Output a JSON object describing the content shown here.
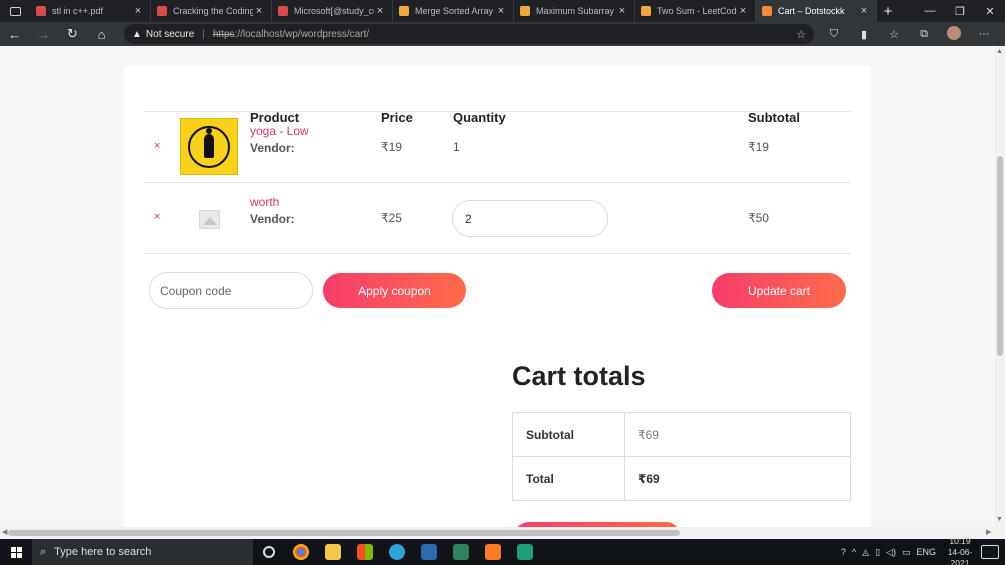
{
  "browser": {
    "tabs": [
      {
        "label": "stl in c++.pdf",
        "color": "#d94b4b",
        "active": false
      },
      {
        "label": "Cracking the Coding",
        "color": "#d94b4b",
        "active": false
      },
      {
        "label": "Microsoft[@study_co",
        "color": "#d94b4b",
        "active": false
      },
      {
        "label": "Merge Sorted Array -",
        "color": "#f2a93b",
        "active": false
      },
      {
        "label": "Maximum Subarray -",
        "color": "#f2a93b",
        "active": false
      },
      {
        "label": "Two Sum - LeetCode",
        "color": "#f2a93b",
        "active": false
      },
      {
        "label": "Cart – Dotstockk",
        "color": "#f58a3a",
        "active": true
      }
    ],
    "security_label": "Not secure",
    "url_scheme": "https",
    "url_rest": "://localhost/wp/wordpress/cart/"
  },
  "cart": {
    "headers": {
      "product": "Product",
      "price": "Price",
      "quantity": "Quantity",
      "subtotal": "Subtotal"
    },
    "items": [
      {
        "remove": "×",
        "name": "yoga - Low",
        "vendor": "Vendor:",
        "price": "₹19",
        "quantity": "1",
        "subtotal": "₹19"
      },
      {
        "remove": "×",
        "name": "worth",
        "vendor": "Vendor:",
        "price": "₹25",
        "quantity": "2",
        "subtotal": "₹50"
      }
    ],
    "coupon_placeholder": "Coupon code",
    "apply_coupon": "Apply coupon",
    "update_cart": "Update cart"
  },
  "totals": {
    "title": "Cart totals",
    "subtotal_label": "Subtotal",
    "subtotal_value": "₹69",
    "total_label": "Total",
    "total_value": "₹69"
  },
  "taskbar": {
    "search_placeholder": "Type here to search",
    "language": "ENG",
    "time": "10:19",
    "date": "14-06-2021"
  },
  "colors": {
    "accent": "#d43a5c",
    "button_start": "#f53d6b",
    "button_end": "#ff6b4a"
  }
}
